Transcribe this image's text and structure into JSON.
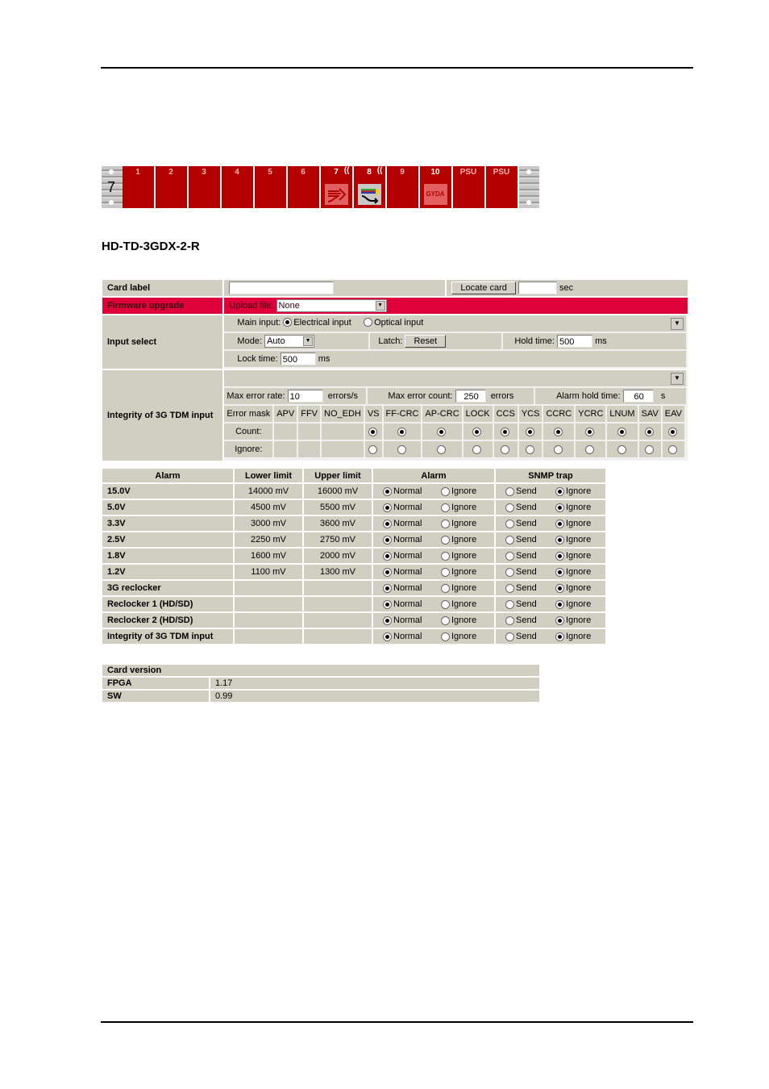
{
  "rack": {
    "rack_number": "7",
    "slots": [
      {
        "label": "1"
      },
      {
        "label": "2"
      },
      {
        "label": "3"
      },
      {
        "label": "4"
      },
      {
        "label": "5"
      },
      {
        "label": "6"
      },
      {
        "label": "7",
        "wireless": true,
        "icon": "arrow-card-icon"
      },
      {
        "label": "8",
        "wireless": true,
        "icon": "multicolor-split-icon",
        "selected": true
      },
      {
        "label": "9"
      },
      {
        "label": "10",
        "icon": "gyda-icon",
        "icon_text": "GYDA"
      },
      {
        "label": "PSU"
      },
      {
        "label": "PSU"
      }
    ]
  },
  "title": "HD-TD-3GDX-2-R",
  "settings": {
    "card_label": {
      "label": "Card label",
      "value": "",
      "locate_button": "Locate card",
      "seconds_value": "",
      "seconds_unit": "sec"
    },
    "firmware": {
      "label": "Firmware upgrade",
      "upload_label": "Upload file:",
      "upload_value": "None"
    },
    "input_select": {
      "label": "Input select",
      "main_input_label": "Main input:",
      "options": [
        {
          "label": "Electrical input",
          "checked": true
        },
        {
          "label": "Optical input",
          "checked": false
        }
      ],
      "mode_label": "Mode:",
      "mode_value": "Auto",
      "latch_label": "Latch:",
      "reset_button": "Reset",
      "hold_time_label": "Hold time:",
      "hold_time_value": "500",
      "hold_time_unit": "ms",
      "lock_time_label": "Lock time:",
      "lock_time_value": "500",
      "lock_time_unit": "ms"
    },
    "integrity": {
      "label": "Integrity of 3G TDM input",
      "max_error_rate_label": "Max error rate:",
      "max_error_rate_value": "10",
      "max_error_rate_unit": "errors/s",
      "max_error_count_label": "Max error count:",
      "max_error_count_value": "250",
      "max_error_count_unit": "errors",
      "alarm_hold_label": "Alarm hold time:",
      "alarm_hold_value": "60",
      "alarm_hold_unit": "s",
      "mask_label": "Error mask",
      "count_label": "Count:",
      "ignore_label": "Ignore:",
      "columns": [
        "APV",
        "FFV",
        "NO_EDH",
        "VS",
        "FF-CRC",
        "AP-CRC",
        "LOCK",
        "CCS",
        "YCS",
        "CCRC",
        "YCRC",
        "LNUM",
        "SAV",
        "EAV"
      ],
      "has_radio": [
        false,
        false,
        false,
        true,
        true,
        true,
        true,
        true,
        true,
        true,
        true,
        true,
        true,
        true
      ]
    }
  },
  "alarms": {
    "headers": [
      "Alarm",
      "Lower limit",
      "Upper limit",
      "Alarm",
      "SNMP trap"
    ],
    "alarm_options": [
      "Normal",
      "Ignore"
    ],
    "snmp_options": [
      "Send",
      "Ignore"
    ],
    "rows": [
      {
        "name": "15.0V",
        "lower": "14000 mV",
        "upper": "16000 mV",
        "alarm": "Normal",
        "snmp": "Ignore"
      },
      {
        "name": "5.0V",
        "lower": "4500 mV",
        "upper": "5500 mV",
        "alarm": "Normal",
        "snmp": "Ignore"
      },
      {
        "name": "3.3V",
        "lower": "3000 mV",
        "upper": "3600 mV",
        "alarm": "Normal",
        "snmp": "Ignore"
      },
      {
        "name": "2.5V",
        "lower": "2250 mV",
        "upper": "2750 mV",
        "alarm": "Normal",
        "snmp": "Ignore"
      },
      {
        "name": "1.8V",
        "lower": "1600 mV",
        "upper": "2000 mV",
        "alarm": "Normal",
        "snmp": "Ignore"
      },
      {
        "name": "1.2V",
        "lower": "1100 mV",
        "upper": "1300 mV",
        "alarm": "Normal",
        "snmp": "Ignore"
      },
      {
        "name": "3G reclocker",
        "lower": "",
        "upper": "",
        "alarm": "Normal",
        "snmp": "Ignore"
      },
      {
        "name": "Reclocker 1 (HD/SD)",
        "lower": "",
        "upper": "",
        "alarm": "Normal",
        "snmp": "Ignore"
      },
      {
        "name": "Reclocker 2 (HD/SD)",
        "lower": "",
        "upper": "",
        "alarm": "Normal",
        "snmp": "Ignore"
      },
      {
        "name": "Integrity of 3G TDM input",
        "lower": "",
        "upper": "",
        "alarm": "Normal",
        "snmp": "Ignore"
      }
    ]
  },
  "version": {
    "header": "Card version",
    "rows": [
      {
        "key": "FPGA",
        "value": "1.17"
      },
      {
        "key": "SW",
        "value": "0.99"
      }
    ]
  }
}
